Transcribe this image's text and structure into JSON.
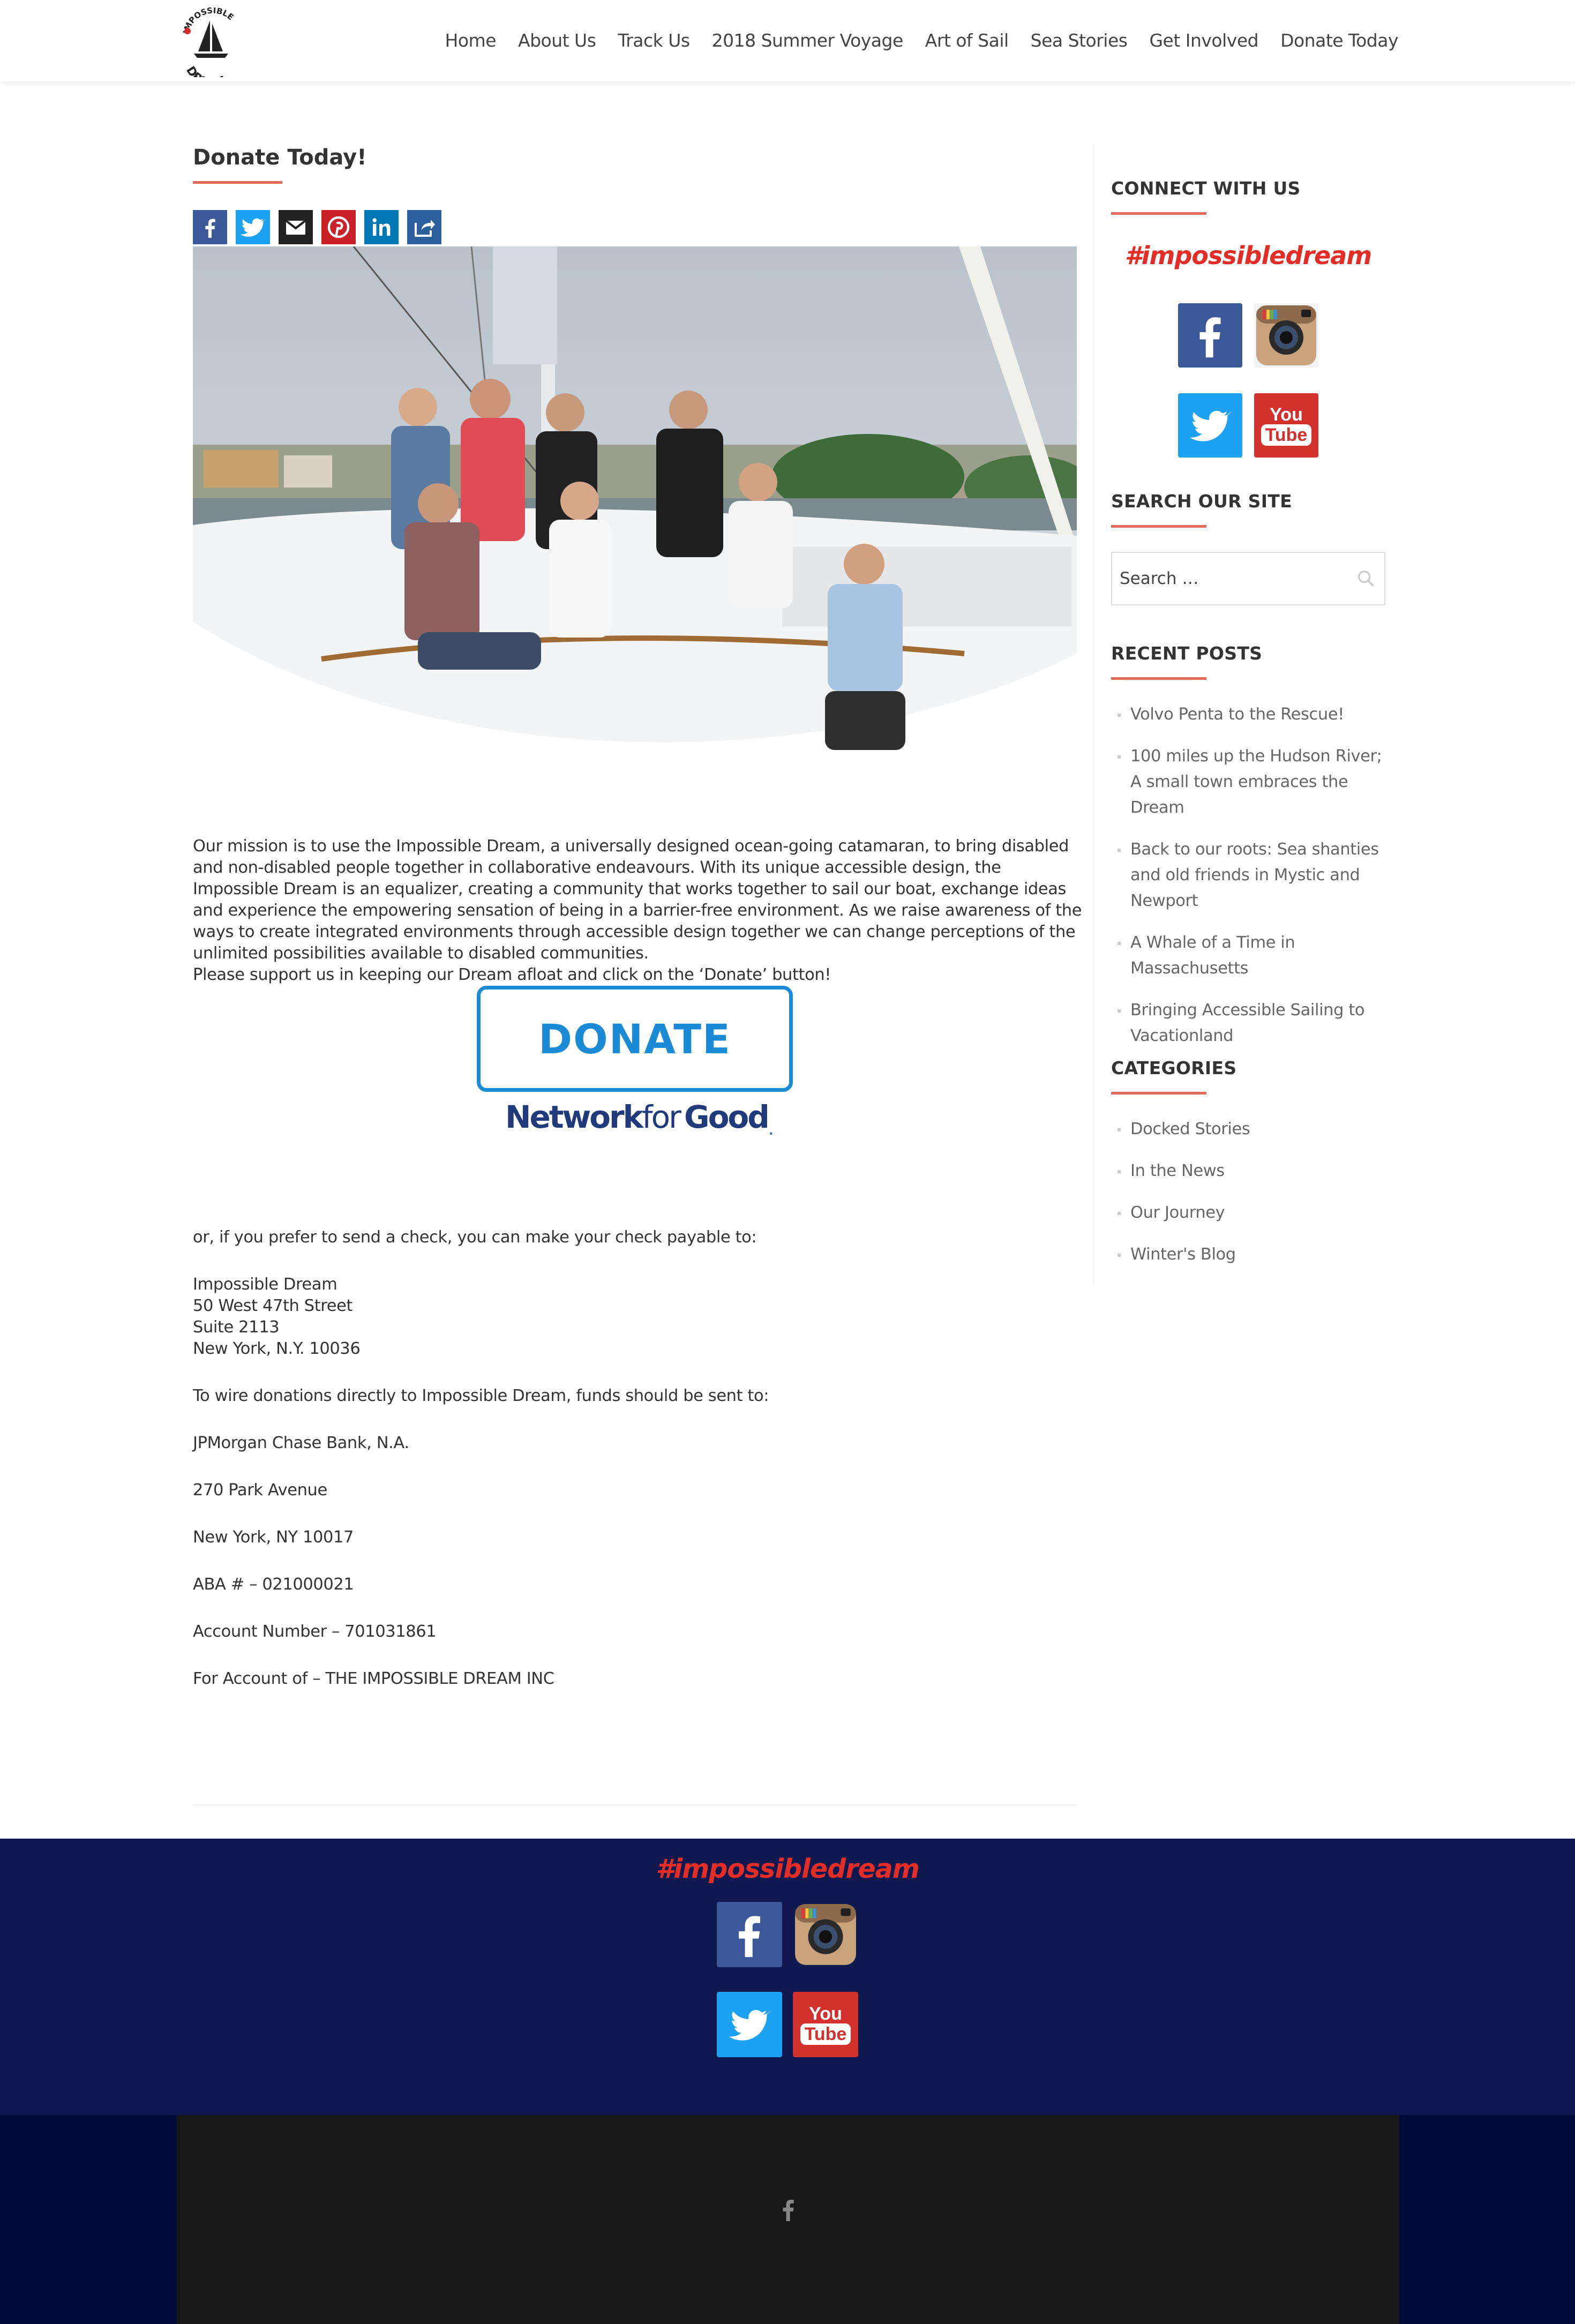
{
  "header": {
    "logo_text_top": "IMPOSSIBLE",
    "logo_text_bottom": "DREAM",
    "nav": [
      "Home",
      "About Us",
      "Track Us",
      "2018 Summer Voyage",
      "Art of Sail",
      "Sea Stories",
      "Get Involved",
      "Donate Today"
    ]
  },
  "main": {
    "title": "Donate Today!",
    "share_icons": [
      "facebook-icon",
      "twitter-icon",
      "email-icon",
      "pinterest-icon",
      "linkedin-icon",
      "share-icon"
    ],
    "paragraph_1": "Our mission is to use the Impossible Dream, a universally designed ocean-going catamaran, to bring disabled and non-disabled people together in collaborative endeavours. With its unique accessible design, the Impossible Dream is an equalizer, creating a community that works together to sail our boat, exchange ideas and experience the empowering sensation of being in a barrier-free environment.  As we raise awareness of the ways to create integrated environments through accessible design together we can change perceptions of the unlimited possibilities available to disabled communities.",
    "paragraph_2": "Please support us in keeping our Dream afloat and click on the ‘Donate’ button!",
    "donate_button": "DONATE",
    "nfg_network": "Network",
    "nfg_for": "for",
    "nfg_good": "Good",
    "nfg_reg": ".",
    "check_intro": "or, if you prefer to send a check, you can make your check payable to:",
    "address": [
      "Impossible Dream",
      "50 West 47th Street",
      "Suite 2113",
      "New York, N.Y. 10036"
    ],
    "wire_intro": "To wire donations directly to Impossible Dream, funds should be sent to:",
    "bank_name": "JPMorgan Chase Bank, N.A.",
    "bank_street": "270 Park Avenue",
    "bank_city": "New York, NY 10017",
    "aba": "ABA # – 021000021",
    "account": "Account Number – 701031861",
    "for_account": "For Account of – THE IMPOSSIBLE DREAM INC"
  },
  "sidebar": {
    "connect_title": "CONNECT WITH US",
    "hashtag": "#impossibledream",
    "search_title": "SEARCH OUR SITE",
    "search_placeholder": "Search …",
    "recent_title": "RECENT POSTS",
    "recent_posts": [
      "Volvo Penta to the Rescue!",
      "100 miles up the Hudson River; A small town embraces the Dream",
      "Back to our roots: Sea shanties and old friends in Mystic and Newport",
      "A Whale of a Time in Massachusetts",
      "Bringing Accessible Sailing to Vacationland"
    ],
    "categories_title": "CATEGORIES",
    "categories": [
      "Docked Stories",
      "In the News",
      "Our Journey",
      "Winter's Blog"
    ]
  },
  "footer": {
    "hashtag": "#impossibledream",
    "youtube_you": "You",
    "youtube_tube": "Tube"
  },
  "colors": {
    "accent": "#e06b5b",
    "hashtag_red": "#e52d27",
    "donate_blue": "#1b8bd6",
    "footer_band": "#0f1950",
    "footer_bottom": "#000b3c"
  }
}
